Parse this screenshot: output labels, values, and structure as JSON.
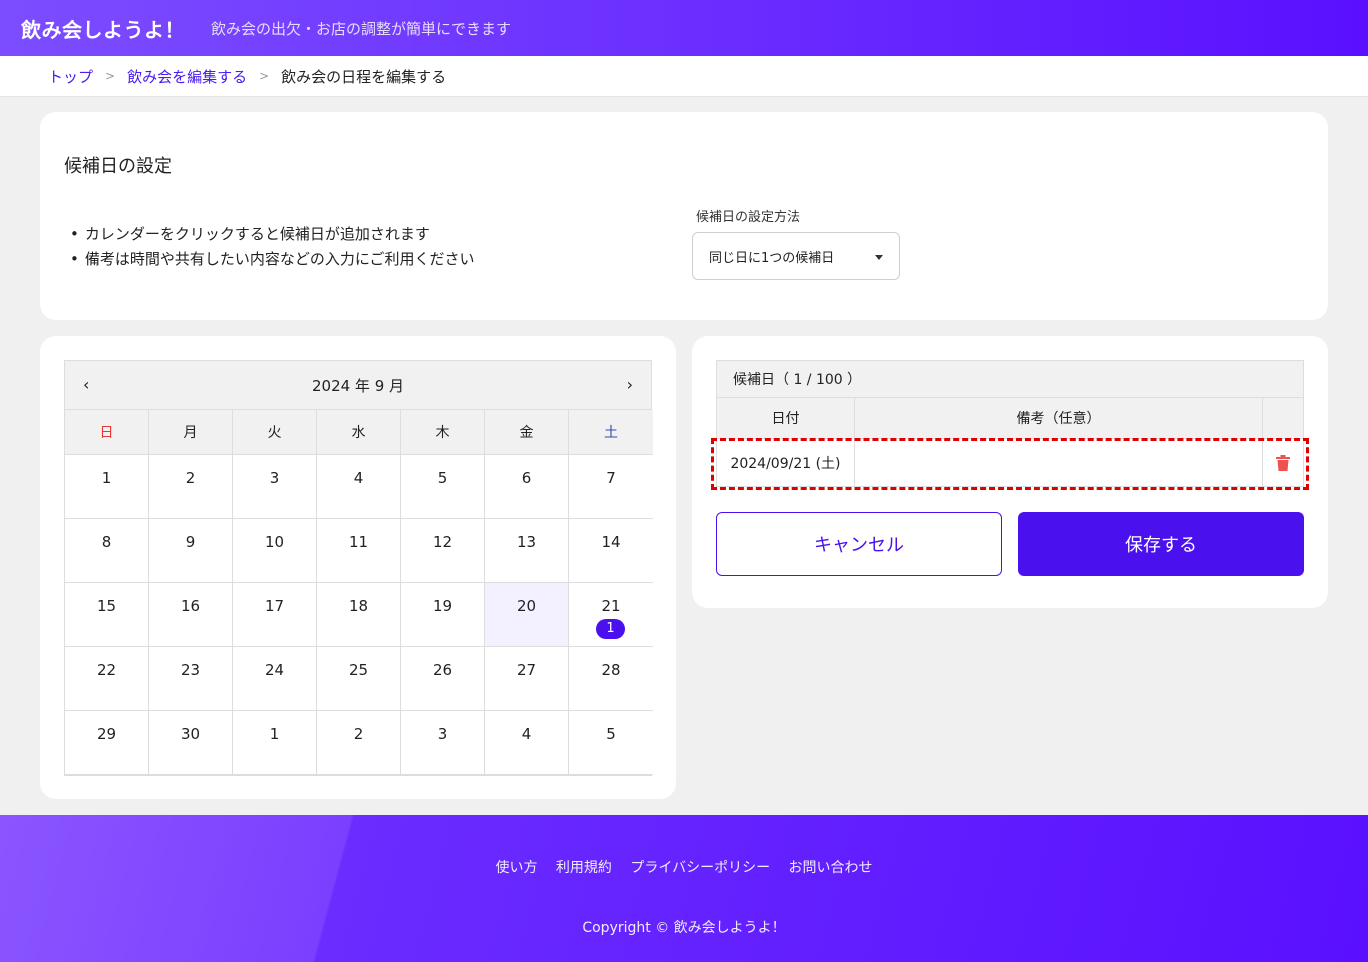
{
  "header": {
    "logo": "飲み会しようよ！",
    "tagline": "飲み会の出欠・お店の調整が簡単にできます"
  },
  "breadcrumb": {
    "items": [
      "トップ",
      "飲み会を編集する"
    ],
    "current": "飲み会の日程を編集する"
  },
  "settings": {
    "title": "候補日の設定",
    "notes": [
      "カレンダーをクリックすると候補日が追加されます",
      "備考は時間や共有したい内容などの入力にご利用ください"
    ],
    "method_label": "候補日の設定方法",
    "method_value": "同じ日に1つの候補日"
  },
  "calendar": {
    "month_label": "2024 年 9 月",
    "weekdays": [
      "日",
      "月",
      "火",
      "水",
      "木",
      "金",
      "土"
    ],
    "weeks": [
      [
        "1",
        "2",
        "3",
        "4",
        "5",
        "6",
        "7"
      ],
      [
        "8",
        "9",
        "10",
        "11",
        "12",
        "13",
        "14"
      ],
      [
        "15",
        "16",
        "17",
        "18",
        "19",
        "20",
        "21"
      ],
      [
        "22",
        "23",
        "24",
        "25",
        "26",
        "27",
        "28"
      ],
      [
        "29",
        "30",
        "1",
        "2",
        "3",
        "4",
        "5"
      ]
    ],
    "today": "20",
    "badge_day": "21",
    "badge_count": "1"
  },
  "candidates": {
    "title": "候補日（ 1 / 100 ）",
    "col_date": "日付",
    "col_note": "備考（任意）",
    "rows": [
      {
        "date": "2024/09/21 (土)",
        "note": ""
      }
    ]
  },
  "buttons": {
    "cancel": "キャンセル",
    "save": "保存する"
  },
  "footer": {
    "links": [
      "使い方",
      "利用規約",
      "プライバシーポリシー",
      "お問い合わせ"
    ],
    "copyright": "Copyright © 飲み会しようよ！"
  },
  "colors": {
    "brand": "#5a10ff",
    "accent": "#4a10ee",
    "danger": "#ef5350"
  }
}
